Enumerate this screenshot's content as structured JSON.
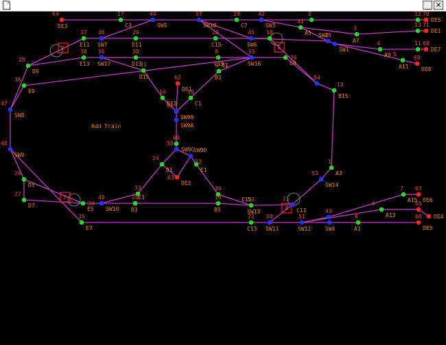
{
  "titlebar": {
    "minimize_label": "_",
    "close_label": "✕"
  },
  "canvas": {
    "add_train_label": "Add Train"
  },
  "colors": {
    "line": "#cc33cc",
    "green_node": "#22dd22",
    "blue_node": "#2233ff",
    "red_node": "#ff2222",
    "label": "#ff8000",
    "number": "#ff4040",
    "marker": "#ff2020",
    "ring": "#708080"
  },
  "nodes": [
    {
      "id": "n64",
      "type": "red",
      "num": "64",
      "num_pos": "above-left",
      "name": "DE3",
      "name_pos": "below"
    },
    {
      "id": "n17",
      "type": "green",
      "num": "17",
      "num_pos": "above",
      "name": "C3",
      "name_pos": "below-right"
    },
    {
      "id": "n44",
      "type": "blue",
      "num": "44",
      "num_pos": "above",
      "name": "SW5",
      "name_pos": "below-right"
    },
    {
      "id": "n57",
      "type": "blue",
      "num": "57",
      "num_pos": "above",
      "name": "SW18",
      "name_pos": "below-right"
    },
    {
      "id": "n19",
      "type": "green",
      "num": "19",
      "num_pos": "above",
      "name": "C7",
      "name_pos": "below-right"
    },
    {
      "id": "n42",
      "type": "blue",
      "num": "42",
      "num_pos": "above",
      "name": "SW3",
      "name_pos": "below-right"
    },
    {
      "id": "n2",
      "type": "green",
      "num": "2",
      "num_pos": "above",
      "name": "",
      "name_pos": ""
    },
    {
      "id": "n41",
      "type": "green",
      "num": "41",
      "num_pos": "above",
      "name": "A5",
      "name_pos": "below-right"
    },
    {
      "id": "n12",
      "type": "green",
      "num": "12",
      "num_pos": "above",
      "name": "",
      "name_pos": ""
    },
    {
      "id": "n70",
      "type": "red",
      "num": "70",
      "num_pos": "above",
      "name": "DE5",
      "name_pos": "right"
    },
    {
      "id": "n37",
      "type": "green",
      "num": "37",
      "num_pos": "above",
      "name": "E11",
      "name_pos": "below"
    },
    {
      "id": "n46",
      "type": "blue",
      "num": "46",
      "num_pos": "above",
      "name": "SW7",
      "name_pos": "below"
    },
    {
      "id": "n29",
      "type": "green",
      "num": "29",
      "num_pos": "above",
      "name": "D11",
      "name_pos": "below"
    },
    {
      "id": "n23",
      "type": "green",
      "num": "23",
      "num_pos": "above",
      "name": "C15",
      "name_pos": "below"
    },
    {
      "id": "n45",
      "type": "blue",
      "num": "45",
      "num_pos": "above",
      "name": "SW6",
      "name_pos": "below"
    },
    {
      "id": "n18",
      "type": "green",
      "num": "18",
      "num_pos": "above",
      "name": "",
      "name_pos": ""
    },
    {
      "id": "n40",
      "type": "blue",
      "num": "40",
      "num_pos": "above",
      "name": "SW2",
      "name_pos": "above-left"
    },
    {
      "id": "n3",
      "type": "green",
      "num": "3",
      "num_pos": "above",
      "name": "A7",
      "name_pos": "below"
    },
    {
      "id": "n13",
      "type": "green",
      "num": "13",
      "num_pos": "above",
      "name": "",
      "name_pos": ""
    },
    {
      "id": "n71",
      "type": "red",
      "num": "71",
      "num_pos": "above",
      "name": "DE1",
      "name_pos": "right"
    },
    {
      "id": "n38",
      "type": "green",
      "num": "38",
      "num_pos": "above",
      "name": "E13",
      "name_pos": "below"
    },
    {
      "id": "n56",
      "type": "blue",
      "num": "56",
      "num_pos": "above",
      "name": "SW17",
      "name_pos": "below"
    },
    {
      "id": "n30",
      "type": "green",
      "num": "30",
      "num_pos": "above",
      "name": "D13",
      "name_pos": "below"
    },
    {
      "id": "n8",
      "type": "green",
      "num": "8",
      "num_pos": "above",
      "name": "C15",
      "name_pos": "below"
    },
    {
      "id": "n55",
      "type": "blue",
      "num": "55",
      "num_pos": "above",
      "name": "SW16",
      "name_pos": "below"
    },
    {
      "id": "n26",
      "type": "green",
      "num": "26",
      "num_pos": "right",
      "name": "C9",
      "name_pos": "below-right"
    },
    {
      "id": "n4",
      "type": "green",
      "num": "4",
      "num_pos": "above",
      "name": "A9",
      "name_pos": "below-right"
    },
    {
      "id": "n11",
      "type": "green",
      "num": "11",
      "num_pos": "above",
      "name": "",
      "name_pos": ""
    },
    {
      "id": "n68",
      "type": "red",
      "num": "68",
      "num_pos": "above",
      "name": "DE7",
      "name_pos": "right"
    },
    {
      "id": "n5",
      "type": "green",
      "num": "5",
      "num_pos": "above-left",
      "name": "A11",
      "name_pos": "below"
    },
    {
      "id": "n69",
      "type": "red",
      "num": "69",
      "num_pos": "above",
      "name": "DE8",
      "name_pos": "below-right"
    },
    {
      "id": "nSW1",
      "type": "blue",
      "num": "",
      "num_pos": "",
      "name": "SW1",
      "name_pos": "below-right"
    },
    {
      "id": "n28",
      "type": "green",
      "num": "28",
      "num_pos": "above-left",
      "name": "D9",
      "name_pos": "below-right"
    },
    {
      "id": "n36",
      "type": "green",
      "num": "36",
      "num_pos": "above-left",
      "name": "E9",
      "name_pos": "below-right"
    },
    {
      "id": "n31",
      "type": "green",
      "num": "31",
      "num_pos": "above",
      "name": "D15",
      "name_pos": "below"
    },
    {
      "id": "n9",
      "type": "green",
      "num": "9",
      "num_pos": "above",
      "name": "B3",
      "name_pos": "below"
    },
    {
      "id": "nB1",
      "type": "green",
      "num": "",
      "num_pos": "",
      "name": "B1",
      "name_pos": "above-right"
    },
    {
      "id": "n54",
      "type": "blue",
      "num": "54",
      "num_pos": "above",
      "name": "",
      "name_pos": ""
    },
    {
      "id": "n15",
      "type": "green",
      "num": "15",
      "num_pos": "above-right",
      "name": "B15",
      "name_pos": "below-right"
    },
    {
      "id": "n47",
      "type": "blue",
      "num": "47",
      "num_pos": "above-left",
      "name": "SW8",
      "name_pos": "below-right"
    },
    {
      "id": "n62",
      "type": "red",
      "num": "62",
      "num_pos": "above",
      "name": "DE1",
      "name_pos": "below-right"
    },
    {
      "id": "n14",
      "type": "green",
      "num": "14",
      "num_pos": "above",
      "name": "D13",
      "name_pos": "below-right"
    },
    {
      "id": "n16",
      "type": "green",
      "num": "16",
      "num_pos": "above",
      "name": "C1",
      "name_pos": "below-right"
    },
    {
      "id": "n61",
      "type": "blue",
      "num": "61",
      "num_pos": "above-left",
      "name": "SW99",
      "name_pos": "below-right"
    },
    {
      "id": "n99",
      "type": "blue",
      "num": "",
      "num_pos": "",
      "name": "SW9A",
      "name_pos": "below-right"
    },
    {
      "id": "n60",
      "type": "green",
      "num": "60",
      "num_pos": "above",
      "name": "",
      "name_pos": ""
    },
    {
      "id": "n58",
      "type": "blue",
      "num": "58",
      "num_pos": "above-left",
      "name": "SW9C",
      "name_pos": "right"
    },
    {
      "id": "n32",
      "type": "blue",
      "num": "32",
      "num_pos": "below-right",
      "name": "SW9D",
      "name_pos": "above-right"
    },
    {
      "id": "n48",
      "type": "blue",
      "num": "48",
      "num_pos": "above-left",
      "name": "SW9",
      "name_pos": "below-right"
    },
    {
      "id": "n24",
      "type": "green",
      "num": "24",
      "num_pos": "above-left",
      "name": "D1",
      "name_pos": "below-right"
    },
    {
      "id": "n63",
      "type": "red",
      "num": "63",
      "num_pos": "left",
      "name": "DE2",
      "name_pos": "below-right"
    },
    {
      "id": "nE1",
      "type": "green",
      "num": "",
      "num_pos": "",
      "name": "E1",
      "name_pos": "below-right"
    },
    {
      "id": "n1",
      "type": "green",
      "num": "1",
      "num_pos": "above",
      "name": "A3",
      "name_pos": "below-right"
    },
    {
      "id": "n53",
      "type": "blue",
      "num": "53",
      "num_pos": "above-left",
      "name": "SW14",
      "name_pos": "below-right"
    },
    {
      "id": "n26b",
      "type": "green",
      "num": "26",
      "num_pos": "above-left",
      "name": "D5",
      "name_pos": "below-right"
    },
    {
      "id": "n33",
      "type": "green",
      "num": "33",
      "num_pos": "above",
      "name": "",
      "name_pos": ""
    },
    {
      "id": "n39",
      "type": "green",
      "num": "39",
      "num_pos": "above",
      "name": "",
      "name_pos": ""
    },
    {
      "id": "n7",
      "type": "green",
      "num": "7",
      "num_pos": "above",
      "name": "A15",
      "name_pos": "below-right"
    },
    {
      "id": "n67",
      "type": "red",
      "num": "67",
      "num_pos": "above",
      "name": "DE6",
      "name_pos": "below-right"
    },
    {
      "id": "n27",
      "type": "green",
      "num": "27",
      "num_pos": "above-left",
      "name": "D7",
      "name_pos": "below-right"
    },
    {
      "id": "n34",
      "type": "green",
      "num": "34",
      "num_pos": "right",
      "name": "E5",
      "name_pos": "below-right"
    },
    {
      "id": "n49",
      "type": "blue",
      "num": "49",
      "num_pos": "above",
      "name": "SW10",
      "name_pos": "below-right"
    },
    {
      "id": "n25",
      "type": "green",
      "num": "25",
      "num_pos": "above",
      "name": "D3",
      "name_pos": "below"
    },
    {
      "id": "nE3",
      "type": "green",
      "num": "",
      "num_pos": "",
      "name": "E3",
      "name_pos": "above-right"
    },
    {
      "id": "n10",
      "type": "green",
      "num": "10",
      "num_pos": "above",
      "name": "B5",
      "name_pos": "below"
    },
    {
      "id": "n52",
      "type": "blue",
      "num": "52",
      "num_pos": "above",
      "name": "SW13",
      "name_pos": "below"
    },
    {
      "id": "nE15",
      "type": "green",
      "num": "",
      "num_pos": "",
      "name": "E15",
      "name_pos": "above-left"
    },
    {
      "id": "n21",
      "type": "blue",
      "num": "21",
      "num_pos": "above-left",
      "name": "C11",
      "name_pos": "below-right"
    },
    {
      "id": "n43",
      "type": "blue",
      "num": "43",
      "num_pos": "above",
      "name": "",
      "name_pos": ""
    },
    {
      "id": "n6",
      "type": "green",
      "num": "6",
      "num_pos": "above-left",
      "name": "A13",
      "name_pos": "below-right"
    },
    {
      "id": "n65",
      "type": "red",
      "num": "65",
      "num_pos": "above",
      "name": "",
      "name_pos": ""
    },
    {
      "id": "n35",
      "type": "green",
      "num": "35",
      "num_pos": "above",
      "name": "E7",
      "name_pos": "below-right"
    },
    {
      "id": "n22",
      "type": "green",
      "num": "22",
      "num_pos": "above",
      "name": "C13",
      "name_pos": "below"
    },
    {
      "id": "n50",
      "type": "blue",
      "num": "50",
      "num_pos": "above",
      "name": "SW11",
      "name_pos": "below"
    },
    {
      "id": "n51",
      "type": "blue",
      "num": "51",
      "num_pos": "above",
      "name": "SW12",
      "name_pos": "below"
    },
    {
      "id": "nSW4",
      "type": "blue",
      "num": "",
      "num_pos": "",
      "name": "SW4",
      "name_pos": "below"
    },
    {
      "id": "n0",
      "type": "green",
      "num": "0",
      "num_pos": "above",
      "name": "A1",
      "name_pos": "below"
    },
    {
      "id": "n66",
      "type": "red",
      "num": "66",
      "num_pos": "above",
      "name": "DE5",
      "name_pos": "below-right"
    },
    {
      "id": "nDE4",
      "type": "red",
      "num": "",
      "num_pos": "",
      "name": "DE4",
      "name_pos": "right"
    }
  ],
  "edges": [
    [
      "n64",
      "n17"
    ],
    [
      "n17",
      "n44"
    ],
    [
      "n44",
      "n57"
    ],
    [
      "n57",
      "n19"
    ],
    [
      "n19",
      "n42"
    ],
    [
      "n42",
      "n2"
    ],
    [
      "n2",
      "n12"
    ],
    [
      "n12",
      "n70"
    ],
    [
      "n42",
      "n41"
    ],
    [
      "n41",
      "n3"
    ],
    [
      "n3",
      "n13"
    ],
    [
      "n13",
      "n71"
    ],
    [
      "n41",
      "n40"
    ],
    [
      "n40",
      "nSW1"
    ],
    [
      "nSW1",
      "n4"
    ],
    [
      "n4",
      "n11"
    ],
    [
      "n11",
      "n68"
    ],
    [
      "nSW1",
      "n5"
    ],
    [
      "n5",
      "n69"
    ],
    [
      "n28",
      "n37"
    ],
    [
      "n37",
      "n46"
    ],
    [
      "n46",
      "n29"
    ],
    [
      "n29",
      "n23"
    ],
    [
      "n23",
      "n45"
    ],
    [
      "n45",
      "n18"
    ],
    [
      "n18",
      "n54"
    ],
    [
      "n44",
      "n46"
    ],
    [
      "n57",
      "n45"
    ],
    [
      "n45",
      "n40"
    ],
    [
      "n28",
      "n38"
    ],
    [
      "n38",
      "n56"
    ],
    [
      "n56",
      "n30"
    ],
    [
      "n30",
      "n8"
    ],
    [
      "n8",
      "n55"
    ],
    [
      "n55",
      "n26"
    ],
    [
      "n26",
      "n54"
    ],
    [
      "n57",
      "n55"
    ],
    [
      "n56",
      "n31"
    ],
    [
      "n31",
      "n14"
    ],
    [
      "n14",
      "n61"
    ],
    [
      "n55",
      "nB1"
    ],
    [
      "nB1",
      "n9"
    ],
    [
      "n9",
      "n16"
    ],
    [
      "n16",
      "n61"
    ],
    [
      "n54",
      "n15"
    ],
    [
      "n15",
      "n1"
    ],
    [
      "n1",
      "n53"
    ],
    [
      "n28",
      "n47"
    ],
    [
      "n36",
      "n47"
    ],
    [
      "n36",
      "n55"
    ],
    [
      "n47",
      "n48"
    ],
    [
      "n48",
      "n26b"
    ],
    [
      "n48",
      "n35"
    ],
    [
      "n26b",
      "n34"
    ],
    [
      "n26b",
      "n27"
    ],
    [
      "n27",
      "n34"
    ],
    [
      "n34",
      "n49"
    ],
    [
      "n49",
      "n25"
    ],
    [
      "n25",
      "n10"
    ],
    [
      "n10",
      "n52"
    ],
    [
      "n52",
      "n21"
    ],
    [
      "n49",
      "n33"
    ],
    [
      "n33",
      "n24"
    ],
    [
      "n24",
      "n58"
    ],
    [
      "n62",
      "n61"
    ],
    [
      "n61",
      "n99"
    ],
    [
      "n99",
      "n60"
    ],
    [
      "n60",
      "n58"
    ],
    [
      "n58",
      "n32"
    ],
    [
      "n32",
      "n63"
    ],
    [
      "n24",
      "n63"
    ],
    [
      "n32",
      "nE1"
    ],
    [
      "nE1",
      "n39"
    ],
    [
      "n39",
      "n52"
    ],
    [
      "n53",
      "n21"
    ],
    [
      "n21",
      "n50"
    ],
    [
      "n35",
      "n22"
    ],
    [
      "n22",
      "n50"
    ],
    [
      "n50",
      "n51"
    ],
    [
      "n51",
      "nSW4"
    ],
    [
      "nSW4",
      "n0"
    ],
    [
      "n0",
      "n66"
    ],
    [
      "n51",
      "n43"
    ],
    [
      "n43",
      "n7"
    ],
    [
      "n7",
      "n67"
    ],
    [
      "n51",
      "n6"
    ],
    [
      "n6",
      "n65"
    ],
    [
      "n65",
      "nDE4"
    ]
  ],
  "markers": [
    {
      "num": "2"
    },
    {
      "num": "3"
    },
    {
      "num": "1"
    },
    {
      "num": "4"
    }
  ]
}
